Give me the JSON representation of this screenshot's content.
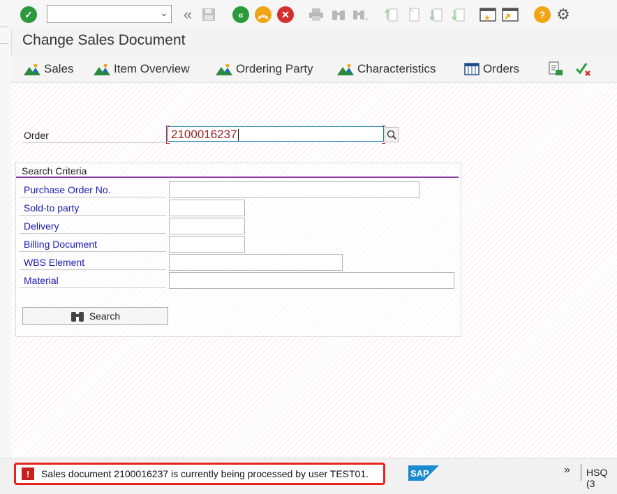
{
  "window": {
    "title": "Change Sales Document"
  },
  "toolbar": {
    "command_value": "",
    "icons": [
      "enter-icon",
      "back-icon",
      "save-icon",
      "exit-icon",
      "up-icon",
      "cancel-icon",
      "print-icon",
      "find-icon",
      "find-next-icon",
      "first-page-icon",
      "previous-page-icon",
      "next-page-icon",
      "last-page-icon",
      "create-session-icon",
      "shortcut-icon",
      "help-icon",
      "settings-icon"
    ]
  },
  "app_toolbar": {
    "sales": "Sales",
    "item_overview": "Item Overview",
    "ordering_party": "Ordering Party",
    "characteristics": "Characteristics",
    "orders": "Orders"
  },
  "form": {
    "order_label": "Order",
    "order_value": "2100016237",
    "search_criteria": {
      "title": "Search Criteria",
      "purchase_order_label": "Purchase Order No.",
      "sold_to_label": "Sold-to party",
      "delivery_label": "Delivery",
      "billing_label": "Billing Document",
      "wbs_label": "WBS Element",
      "material_label": "Material",
      "search_button": "Search"
    }
  },
  "status": {
    "message": "Sales document 2100016237 is currently being processed by user TEST01.",
    "severity_icon": "!",
    "system": "HSQ (3",
    "logo": "SAP"
  },
  "colors": {
    "error": "#e8231f",
    "sap_blue": "#1a8bd0",
    "enter_green": "#2a9a3c",
    "cancel_red": "#d32f2f"
  }
}
